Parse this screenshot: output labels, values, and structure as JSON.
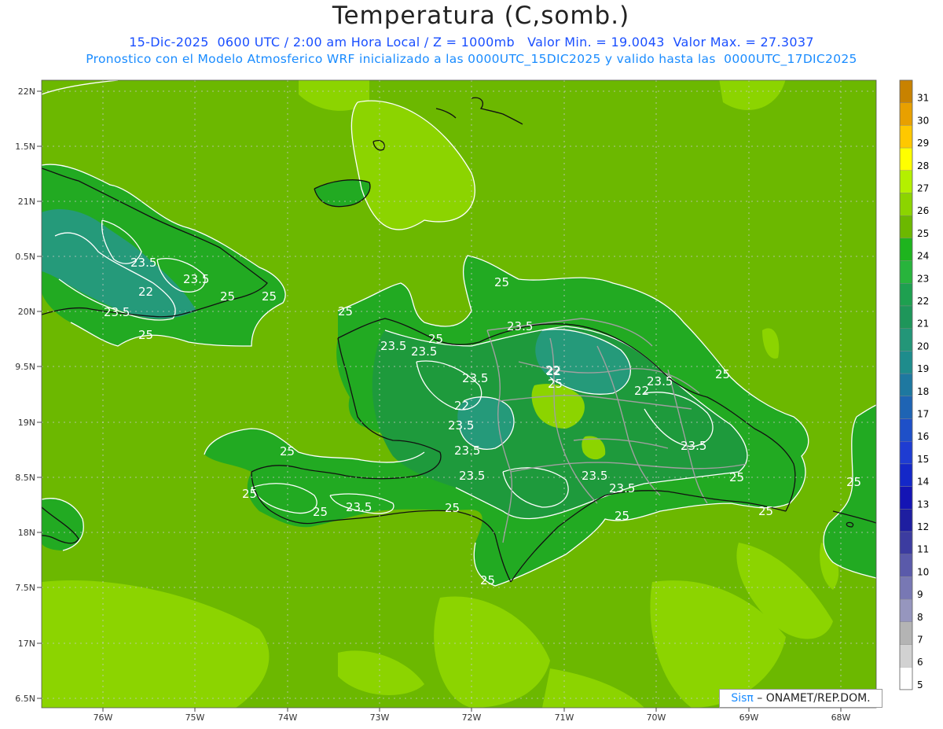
{
  "header": {
    "title": "Temperatura (C,somb.)",
    "subtitle_line1": "15-Dic-2025  0600 UTC / 2:00 am Hora Local / Z = 1000mb   Valor Min. = 19.0043  Valor Max. = 27.3037",
    "subtitle_line2": "Pronostico con el Modelo Atmosferico WRF inicializado a las 0000UTC_15DIC2025 y valido hasta las  0000UTC_17DIC2025"
  },
  "map": {
    "lon_labels": [
      "76W",
      "75W",
      "74W",
      "73W",
      "72W",
      "71W",
      "70W",
      "69W",
      "68W"
    ],
    "lat_labels": [
      "22N",
      "1.5N",
      "21N",
      "0.5N",
      "20N",
      "9.5N",
      "19N",
      "8.5N",
      "18N",
      "7.5N",
      "17N",
      "6.5N"
    ],
    "contour_labels": [
      "23.5",
      "23.5",
      "22",
      "23.5",
      "25",
      "25",
      "25",
      "25",
      "25",
      "23.5",
      "23.5",
      "25",
      "22",
      "25",
      "22",
      "23.5",
      "23.5",
      "22",
      "23.5",
      "23.5",
      "23.5",
      "23.5",
      "23.5",
      "23.5",
      "25",
      "25",
      "25",
      "25",
      "25",
      "23.5",
      "25",
      "25",
      "25",
      "22",
      "23.5",
      "25",
      "25"
    ],
    "colors": {
      "sea_base": "#6cb800",
      "sea_light": "#8cd400",
      "land_green": "#22aa22",
      "land_dark": "#1e9a3c",
      "teal": "#259a7a",
      "coast": "#111111",
      "border": "#999999",
      "contour": "#ffffff"
    }
  },
  "legend": {
    "values": [
      "31",
      "30",
      "29",
      "28",
      "27",
      "26",
      "25",
      "24",
      "23",
      "22",
      "21",
      "20",
      "19",
      "18",
      "17",
      "16",
      "15",
      "14",
      "13",
      "12",
      "11",
      "10",
      "9",
      "8",
      "7",
      "6",
      "5"
    ],
    "colors": [
      "#c88200",
      "#e8a000",
      "#ffc800",
      "#ffff00",
      "#b4f000",
      "#8cd400",
      "#6cb800",
      "#1eb41e",
      "#28b43c",
      "#1ea050",
      "#1e965a",
      "#239678",
      "#1e8c8c",
      "#1e78a0",
      "#1e64b4",
      "#1e50c8",
      "#1e3cd2",
      "#1428c8",
      "#1414b4",
      "#1e1ea0",
      "#3c3ca0",
      "#5a5aaa",
      "#7878b4",
      "#9696be",
      "#b4b4b4",
      "#d2d2d2",
      "#ffffff"
    ]
  },
  "credit": {
    "sis": "Sisπ",
    "text": "ONAMET/REP.DOM."
  }
}
